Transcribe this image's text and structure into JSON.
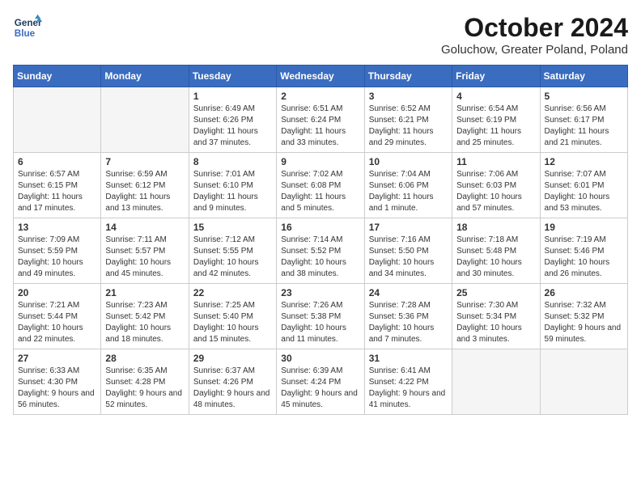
{
  "header": {
    "logo_line1": "General",
    "logo_line2": "Blue",
    "month": "October 2024",
    "location": "Goluchow, Greater Poland, Poland"
  },
  "weekdays": [
    "Sunday",
    "Monday",
    "Tuesday",
    "Wednesday",
    "Thursday",
    "Friday",
    "Saturday"
  ],
  "weeks": [
    [
      {
        "day": "",
        "info": ""
      },
      {
        "day": "",
        "info": ""
      },
      {
        "day": "1",
        "info": "Sunrise: 6:49 AM\nSunset: 6:26 PM\nDaylight: 11 hours and 37 minutes."
      },
      {
        "day": "2",
        "info": "Sunrise: 6:51 AM\nSunset: 6:24 PM\nDaylight: 11 hours and 33 minutes."
      },
      {
        "day": "3",
        "info": "Sunrise: 6:52 AM\nSunset: 6:21 PM\nDaylight: 11 hours and 29 minutes."
      },
      {
        "day": "4",
        "info": "Sunrise: 6:54 AM\nSunset: 6:19 PM\nDaylight: 11 hours and 25 minutes."
      },
      {
        "day": "5",
        "info": "Sunrise: 6:56 AM\nSunset: 6:17 PM\nDaylight: 11 hours and 21 minutes."
      }
    ],
    [
      {
        "day": "6",
        "info": "Sunrise: 6:57 AM\nSunset: 6:15 PM\nDaylight: 11 hours and 17 minutes."
      },
      {
        "day": "7",
        "info": "Sunrise: 6:59 AM\nSunset: 6:12 PM\nDaylight: 11 hours and 13 minutes."
      },
      {
        "day": "8",
        "info": "Sunrise: 7:01 AM\nSunset: 6:10 PM\nDaylight: 11 hours and 9 minutes."
      },
      {
        "day": "9",
        "info": "Sunrise: 7:02 AM\nSunset: 6:08 PM\nDaylight: 11 hours and 5 minutes."
      },
      {
        "day": "10",
        "info": "Sunrise: 7:04 AM\nSunset: 6:06 PM\nDaylight: 11 hours and 1 minute."
      },
      {
        "day": "11",
        "info": "Sunrise: 7:06 AM\nSunset: 6:03 PM\nDaylight: 10 hours and 57 minutes."
      },
      {
        "day": "12",
        "info": "Sunrise: 7:07 AM\nSunset: 6:01 PM\nDaylight: 10 hours and 53 minutes."
      }
    ],
    [
      {
        "day": "13",
        "info": "Sunrise: 7:09 AM\nSunset: 5:59 PM\nDaylight: 10 hours and 49 minutes."
      },
      {
        "day": "14",
        "info": "Sunrise: 7:11 AM\nSunset: 5:57 PM\nDaylight: 10 hours and 45 minutes."
      },
      {
        "day": "15",
        "info": "Sunrise: 7:12 AM\nSunset: 5:55 PM\nDaylight: 10 hours and 42 minutes."
      },
      {
        "day": "16",
        "info": "Sunrise: 7:14 AM\nSunset: 5:52 PM\nDaylight: 10 hours and 38 minutes."
      },
      {
        "day": "17",
        "info": "Sunrise: 7:16 AM\nSunset: 5:50 PM\nDaylight: 10 hours and 34 minutes."
      },
      {
        "day": "18",
        "info": "Sunrise: 7:18 AM\nSunset: 5:48 PM\nDaylight: 10 hours and 30 minutes."
      },
      {
        "day": "19",
        "info": "Sunrise: 7:19 AM\nSunset: 5:46 PM\nDaylight: 10 hours and 26 minutes."
      }
    ],
    [
      {
        "day": "20",
        "info": "Sunrise: 7:21 AM\nSunset: 5:44 PM\nDaylight: 10 hours and 22 minutes."
      },
      {
        "day": "21",
        "info": "Sunrise: 7:23 AM\nSunset: 5:42 PM\nDaylight: 10 hours and 18 minutes."
      },
      {
        "day": "22",
        "info": "Sunrise: 7:25 AM\nSunset: 5:40 PM\nDaylight: 10 hours and 15 minutes."
      },
      {
        "day": "23",
        "info": "Sunrise: 7:26 AM\nSunset: 5:38 PM\nDaylight: 10 hours and 11 minutes."
      },
      {
        "day": "24",
        "info": "Sunrise: 7:28 AM\nSunset: 5:36 PM\nDaylight: 10 hours and 7 minutes."
      },
      {
        "day": "25",
        "info": "Sunrise: 7:30 AM\nSunset: 5:34 PM\nDaylight: 10 hours and 3 minutes."
      },
      {
        "day": "26",
        "info": "Sunrise: 7:32 AM\nSunset: 5:32 PM\nDaylight: 9 hours and 59 minutes."
      }
    ],
    [
      {
        "day": "27",
        "info": "Sunrise: 6:33 AM\nSunset: 4:30 PM\nDaylight: 9 hours and 56 minutes."
      },
      {
        "day": "28",
        "info": "Sunrise: 6:35 AM\nSunset: 4:28 PM\nDaylight: 9 hours and 52 minutes."
      },
      {
        "day": "29",
        "info": "Sunrise: 6:37 AM\nSunset: 4:26 PM\nDaylight: 9 hours and 48 minutes."
      },
      {
        "day": "30",
        "info": "Sunrise: 6:39 AM\nSunset: 4:24 PM\nDaylight: 9 hours and 45 minutes."
      },
      {
        "day": "31",
        "info": "Sunrise: 6:41 AM\nSunset: 4:22 PM\nDaylight: 9 hours and 41 minutes."
      },
      {
        "day": "",
        "info": ""
      },
      {
        "day": "",
        "info": ""
      }
    ]
  ]
}
